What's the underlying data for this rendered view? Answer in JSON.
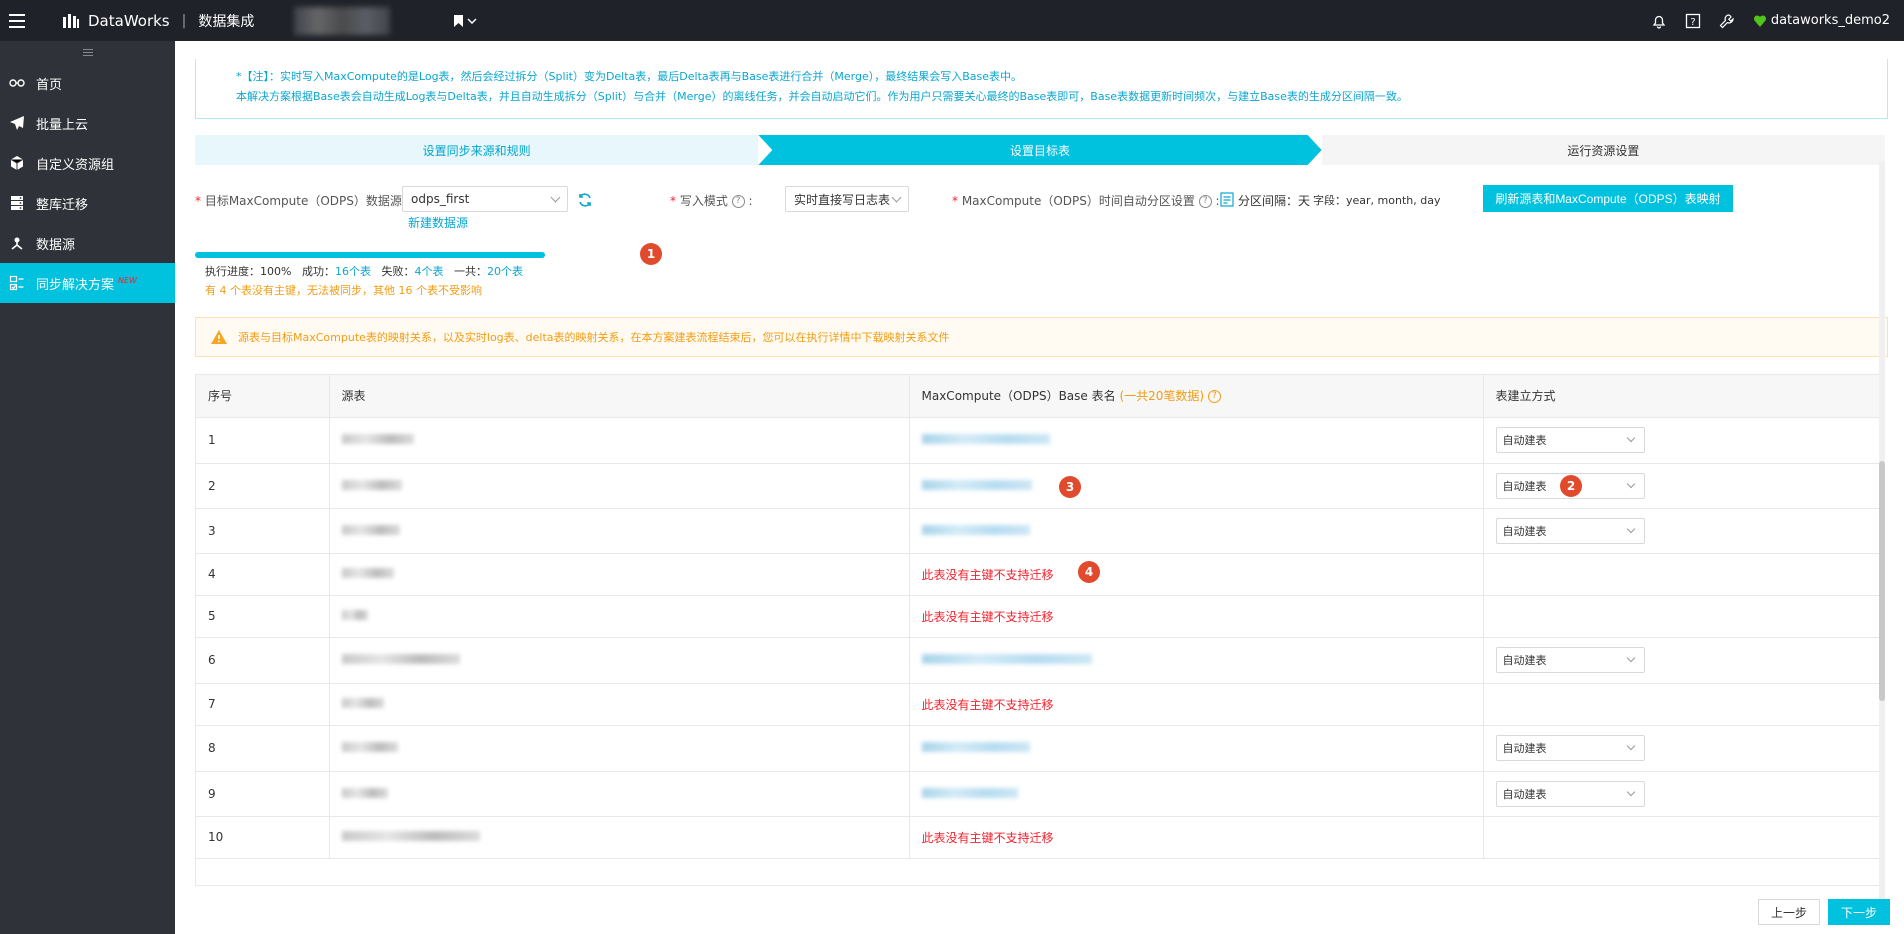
{
  "topbar": {
    "brand": "DataWorks",
    "product": "数据集成",
    "user": "dataworks_demo2",
    "icons": [
      "bell-icon",
      "help-icon",
      "wrench-icon",
      "shield-heart-icon"
    ]
  },
  "sidebar": {
    "items": [
      {
        "label": "首页",
        "icon": "glasses-icon"
      },
      {
        "label": "批量上云",
        "icon": "paper-plane-icon"
      },
      {
        "label": "自定义资源组",
        "icon": "cube-icon"
      },
      {
        "label": "整库迁移",
        "icon": "server-icon"
      },
      {
        "label": "数据源",
        "icon": "fork-icon"
      },
      {
        "label": "同步解决方案",
        "icon": "checklist-icon",
        "badge": "NEW",
        "active": true
      }
    ]
  },
  "note": {
    "line1": "*【注】：实时写入MaxCompute的是Log表，然后会经过拆分（Split）变为Delta表，最后Delta表再与Base表进行合并（Merge），最终结果会写入Base表中。",
    "line2": "本解决方案根据Base表会自动生成Log表与Delta表，并且自动生成拆分（Split）与合并（Merge）的离线任务，并会自动启动它们。作为用户只需要关心最终的Base表即可，Base表数据更新时间频次，与建立Base表的生成分区间隔一致。"
  },
  "steps": [
    "设置同步来源和规则",
    "设置目标表",
    "运行资源设置"
  ],
  "form": {
    "target_label": "目标MaxCompute（ODPS）数据源:",
    "target_value": "odps_first",
    "new_source": "新建数据源",
    "write_mode_label": "写入模式",
    "write_mode_value": "实时直接写日志表",
    "partition_label": "MaxCompute（ODPS）时间自动分区设置",
    "partition_interval": "分区间隔：天",
    "partition_fields": "字段：year, month, day",
    "refresh_button": "刷新源表和MaxCompute（ODPS）表映射"
  },
  "progress": {
    "value": 1.0,
    "label": "执行进度：100%",
    "success_label": "成功：",
    "success_value": "16个表",
    "fail_label": "失败：",
    "fail_value": "4个表",
    "total_label": "一共：",
    "total_value": "20个表",
    "warning": "有 4 个表没有主键，无法被同步，其他 16 个表不受影响"
  },
  "badges": [
    "1",
    "2",
    "3",
    "4"
  ],
  "alert": "源表与目标MaxCompute表的映射关系，以及实时log表、delta表的映射关系，在本方案建表流程结束后，您可以在执行详情中下载映射关系文件",
  "table": {
    "headers": {
      "index": "序号",
      "source": "源表",
      "target": "MaxCompute（ODPS）Base 表名",
      "target_hint": "(一共20笔数据)",
      "method": "表建立方式"
    },
    "rows": [
      {
        "index": "1",
        "ok": true,
        "method": "自动建表"
      },
      {
        "index": "2",
        "ok": true,
        "method": "自动建表"
      },
      {
        "index": "3",
        "ok": true,
        "method": "自动建表"
      },
      {
        "index": "4",
        "ok": false,
        "error": "此表没有主键不支持迁移"
      },
      {
        "index": "5",
        "ok": false,
        "error": "此表没有主键不支持迁移"
      },
      {
        "index": "6",
        "ok": true,
        "method": "自动建表"
      },
      {
        "index": "7",
        "ok": false,
        "error": "此表没有主键不支持迁移"
      },
      {
        "index": "8",
        "ok": true,
        "method": "自动建表"
      },
      {
        "index": "9",
        "ok": true,
        "method": "自动建表"
      },
      {
        "index": "10",
        "ok": false,
        "error": "此表没有主键不支持迁移"
      }
    ]
  },
  "footer": {
    "prev": "上一步",
    "next": "下一步"
  }
}
